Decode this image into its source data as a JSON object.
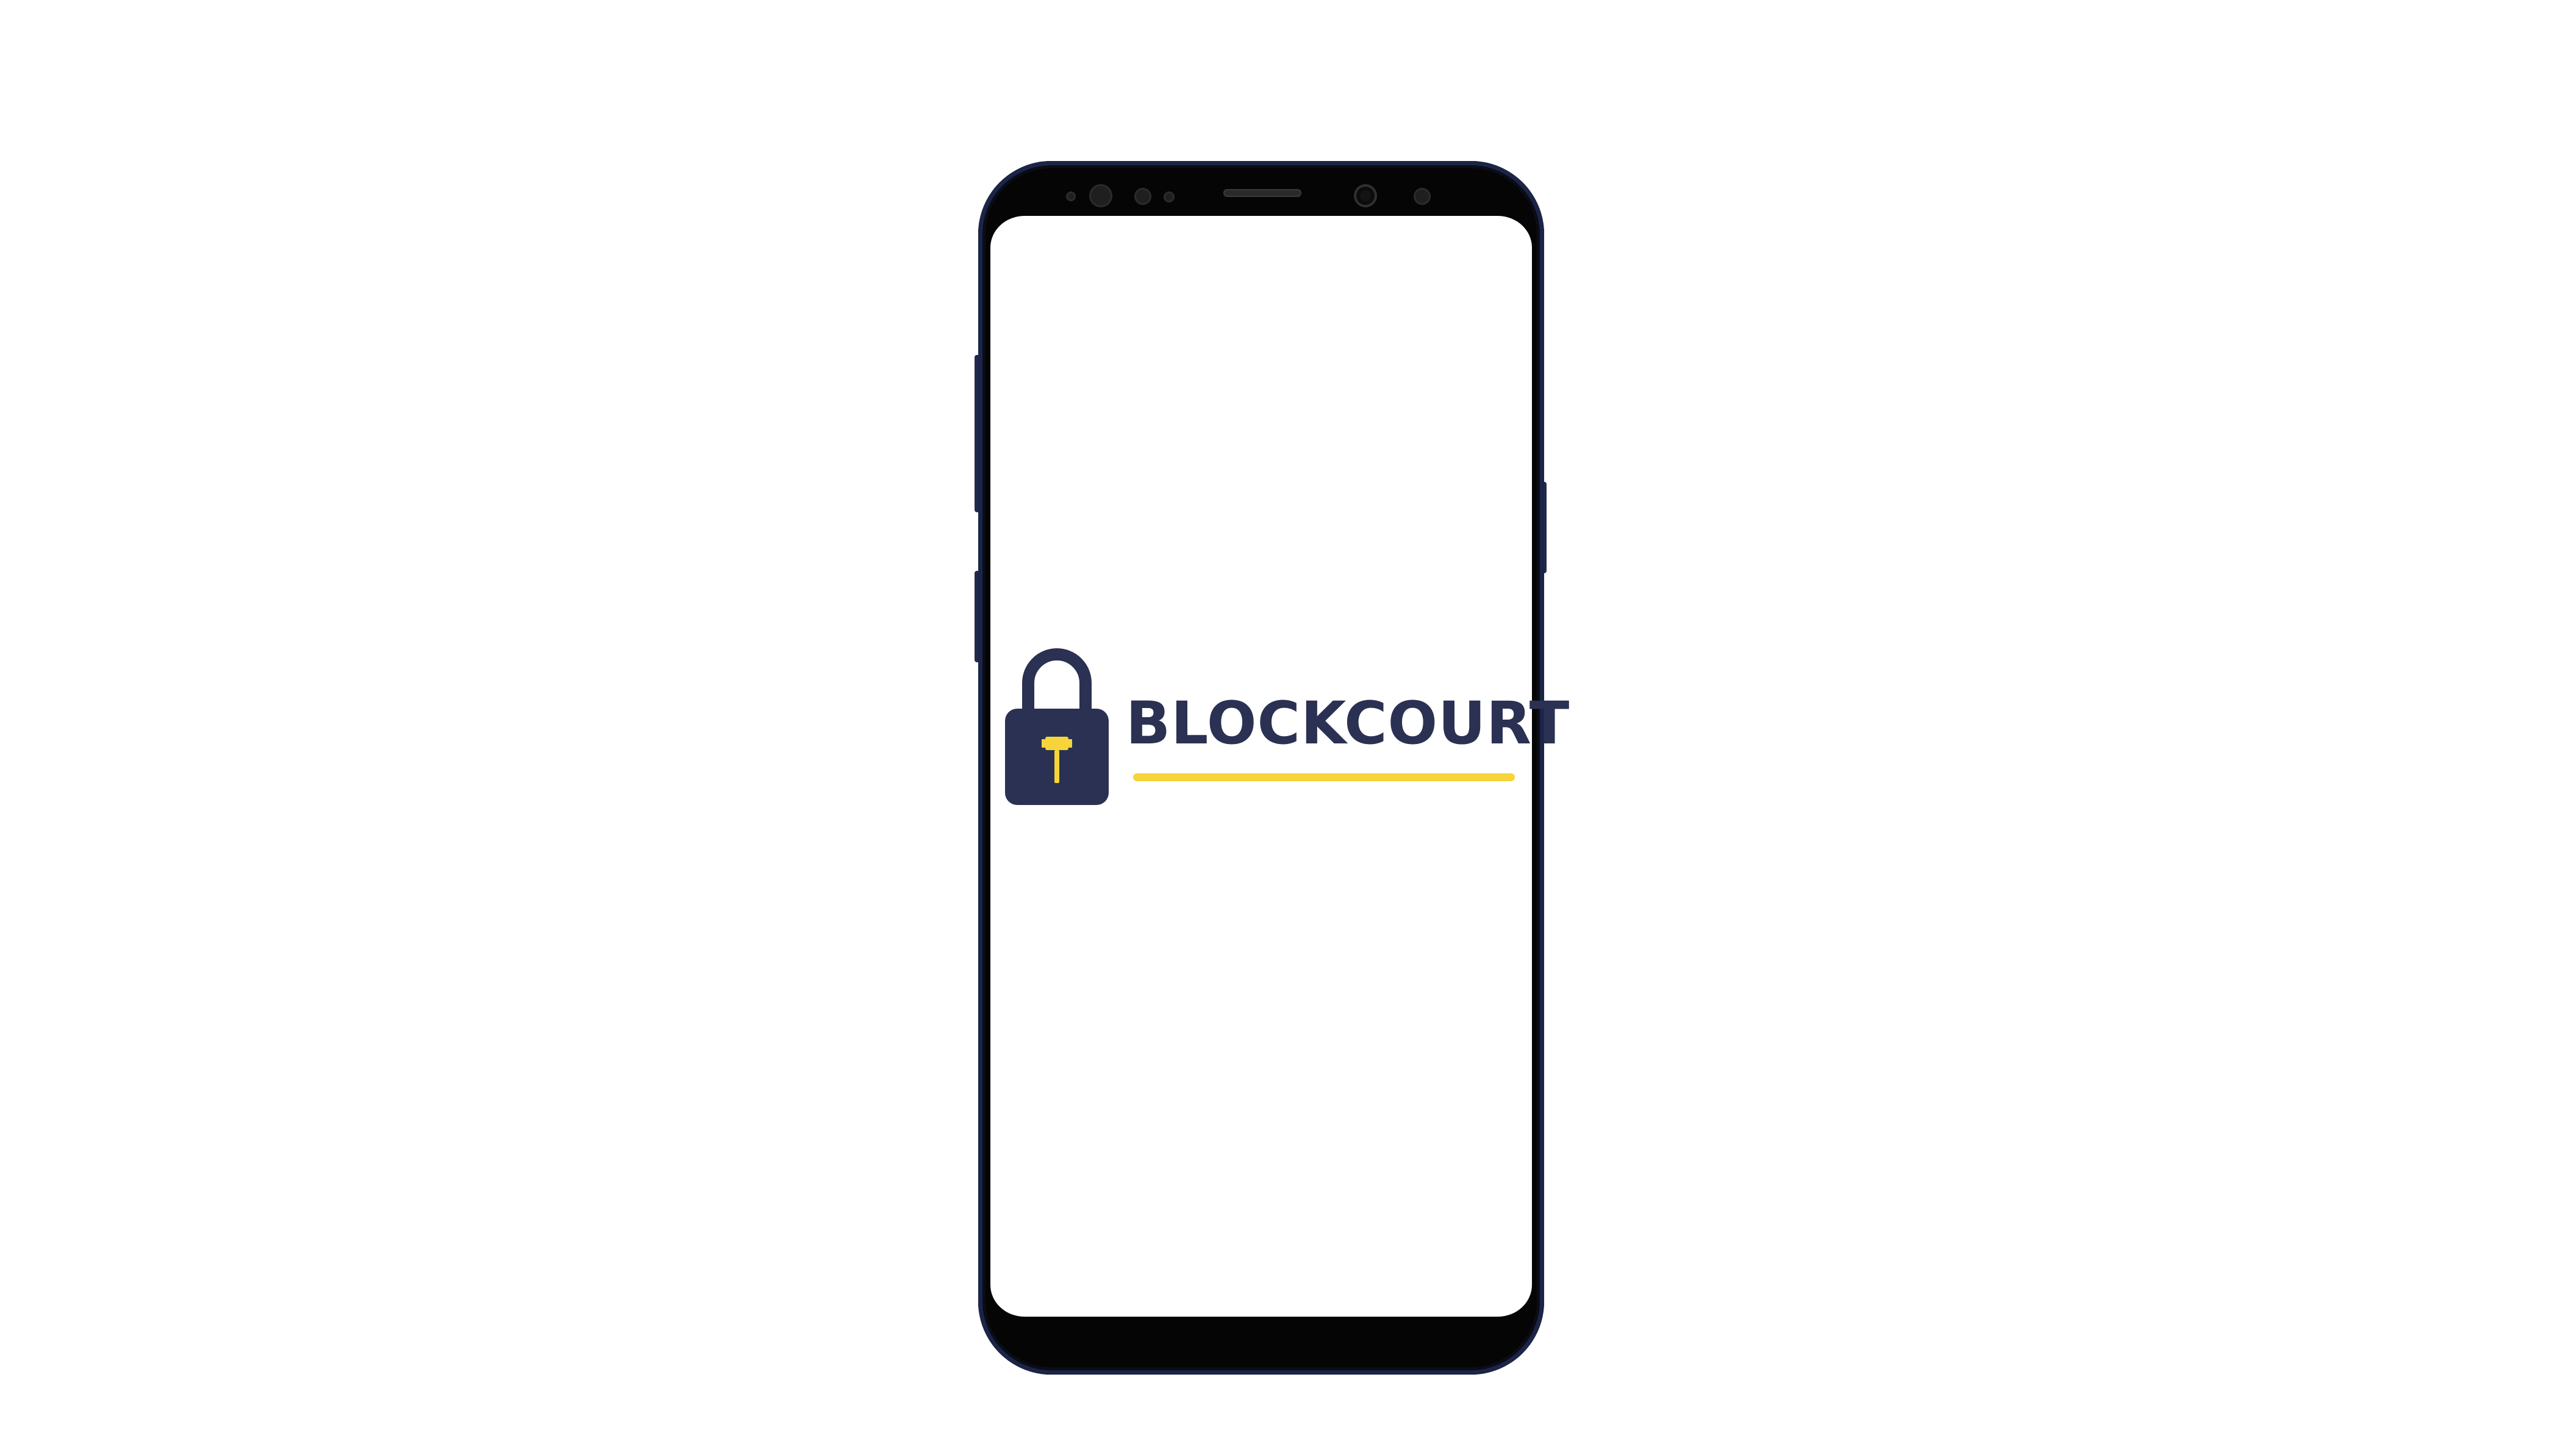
{
  "app": {
    "brand_name": "BLOCKCOURT",
    "logo_icon": "padlock-gavel-icon"
  },
  "device": {
    "model_style": "smartphone-frame",
    "frame_color": "#1c2547",
    "screen_color": "#ffffff"
  },
  "colors": {
    "brand_navy": "#2a3152",
    "brand_yellow": "#f6d43a"
  }
}
